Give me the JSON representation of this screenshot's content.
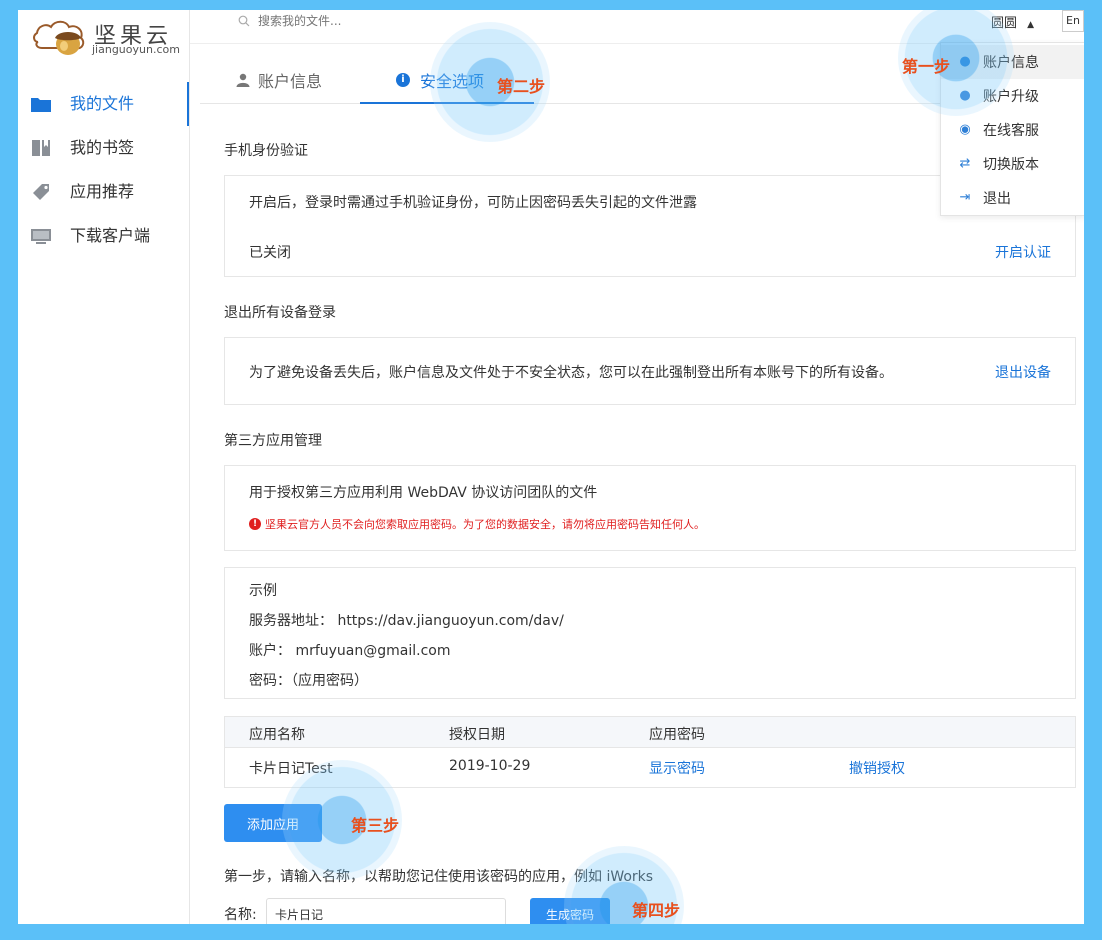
{
  "brand": {
    "name": "坚果云",
    "domain": "jianguoyun.com"
  },
  "sidebar": {
    "items": [
      {
        "label": "我的文件",
        "icon": "folder-icon",
        "active": true
      },
      {
        "label": "我的书签",
        "icon": "bookmark-icon",
        "active": false
      },
      {
        "label": "应用推荐",
        "icon": "tag-icon",
        "active": false
      },
      {
        "label": "下载客户端",
        "icon": "monitor-icon",
        "active": false
      }
    ]
  },
  "header": {
    "search_placeholder": "搜索我的文件...",
    "user_name": "圆圆",
    "lang": "En"
  },
  "tabs": [
    {
      "label": "账户信息",
      "icon": "user-icon",
      "active": false
    },
    {
      "label": "安全选项",
      "icon": "info-icon",
      "active": true
    }
  ],
  "dropdown": {
    "items": [
      {
        "label": "账户信息",
        "icon": "user-icon"
      },
      {
        "label": "账户升级",
        "icon": "user-upgrade-icon"
      },
      {
        "label": "在线客服",
        "icon": "headset-icon"
      },
      {
        "label": "切换版本",
        "icon": "swap-icon"
      },
      {
        "label": "退出",
        "icon": "logout-icon"
      }
    ]
  },
  "phone_auth": {
    "title": "手机身份验证",
    "description": "开启后，登录时需通过手机验证身份，可防止因密码丢失引起的文件泄露",
    "status": "已关闭",
    "action": "开启认证"
  },
  "logout_all": {
    "title": "退出所有设备登录",
    "description": "为了避免设备丢失后，账户信息及文件处于不安全状态，您可以在此强制登出所有本账号下的所有设备。",
    "action": "退出设备"
  },
  "third_party": {
    "title": "第三方应用管理",
    "description": "用于授权第三方应用利用 WebDAV 协议访问团队的文件",
    "warning": "坚果云官方人员不会向您索取应用密码。为了您的数据安全，请勿将应用密码告知任何人。",
    "example": {
      "title": "示例",
      "server": "服务器地址：  https://dav.jianguoyun.com/dav/",
      "account": "账户：  mrfuyuan@gmail.com",
      "password": "密码：（应用密码）"
    },
    "table": {
      "headers": [
        "应用名称",
        "授权日期",
        "应用密码"
      ],
      "rows": [
        {
          "name": "卡片日记Test",
          "date": "2019-10-29",
          "show": "显示密码",
          "revoke": "撤销授权"
        }
      ]
    },
    "add_button": "添加应用",
    "step_hint": "第一步，请输入名称，以帮助您记住使用该密码的应用，例如 iWorks",
    "name_label": "名称:",
    "name_value": "卡片日记",
    "generate_button": "生成密码"
  },
  "steps": [
    "第一步",
    "第二步",
    "第三步",
    "第四步"
  ]
}
